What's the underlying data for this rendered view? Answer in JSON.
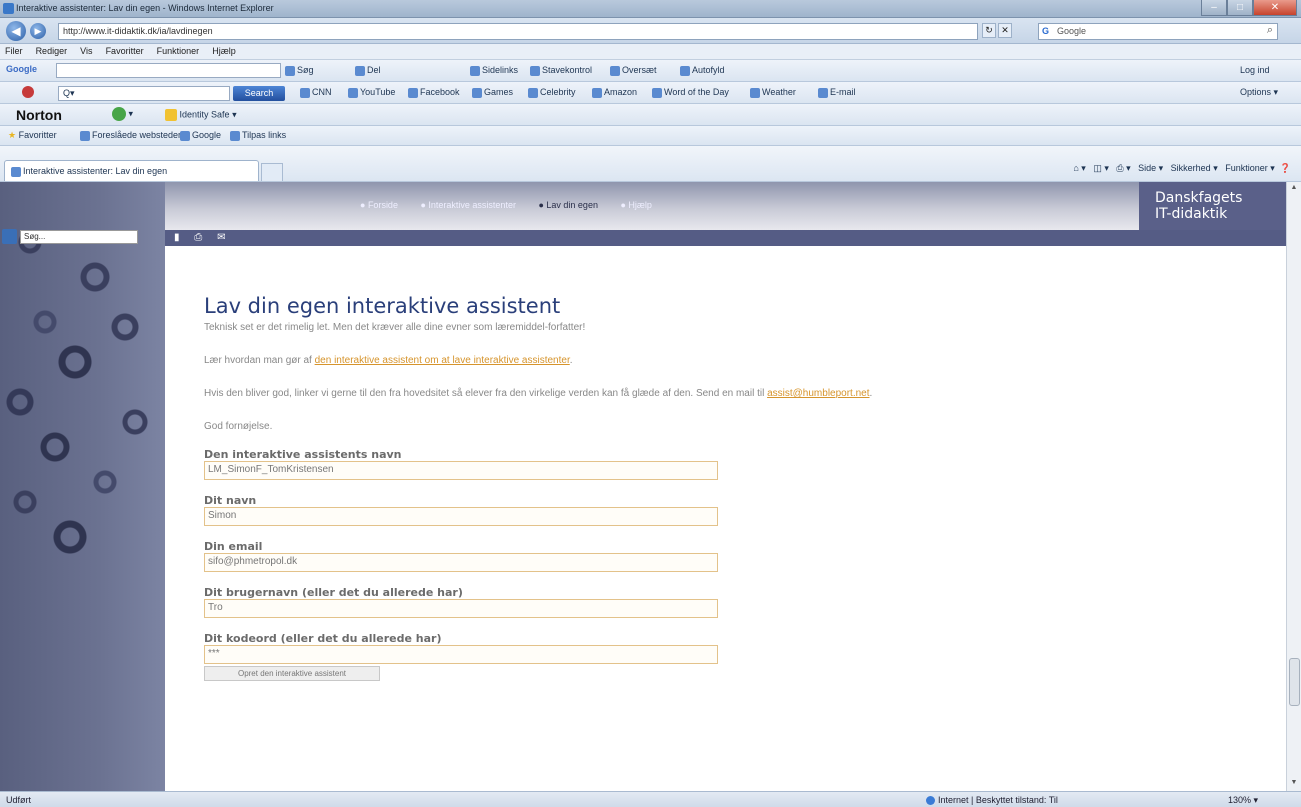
{
  "window": {
    "title": "Interaktive assistenter: Lav din egen - Windows Internet Explorer"
  },
  "addressbar": {
    "url": "http://www.it-didaktik.dk/ia/lavdinegen",
    "search_engine": "Google",
    "search_placeholder": "Google"
  },
  "menubar": [
    "Filer",
    "Rediger",
    "Vis",
    "Favoritter",
    "Funktioner",
    "Hjælp"
  ],
  "google_toolbar": {
    "label": "Google",
    "items": [
      "Søg",
      "Del",
      "Sidelinks",
      "Stavekontrol",
      "Oversæt",
      "Autofyld"
    ],
    "right": "Log ind"
  },
  "ask_toolbar": {
    "search_button": "Search",
    "items": [
      "CNN",
      "YouTube",
      "Facebook",
      "Games",
      "Celebrity",
      "Amazon",
      "Word of the Day",
      "Weather",
      "E-mail"
    ],
    "right": "Options"
  },
  "norton_toolbar": {
    "brand": "Norton",
    "item": "Identity Safe"
  },
  "favorites_bar": {
    "label": "Favoritter",
    "items": [
      "Foreslåede websteder",
      "Google",
      "Tilpas links"
    ]
  },
  "tabs": [
    {
      "label": "Interaktive assistenter: Lav din egen"
    }
  ],
  "commandbar": {
    "items": [
      "Side",
      "Sikkerhed",
      "Funktioner"
    ]
  },
  "site": {
    "search_value": "Søg...",
    "nav_links": [
      "Forside",
      "Interaktive assistenter",
      "Lav din egen",
      "Hjælp"
    ],
    "current_nav": "Lav din egen",
    "brand_line1": "Danskfagets",
    "brand_line2": "IT-didaktik"
  },
  "content": {
    "heading": "Lav din egen interaktive assistent",
    "intro": "Teknisk set er det rimelig let. Men det kræver alle dine evner som læremiddel-forfatter!",
    "learn_prefix": "Lær hvordan man gør af ",
    "learn_link": "den interaktive assistent om at lave interaktive assistenter",
    "learn_suffix": ".",
    "share_text": "Hvis den bliver god, linker vi gerne til den fra hovedsitet så elever fra den virkelige verden kan få glæde af den. Send en mail til ",
    "share_email": "assist@humbleport.net",
    "share_suffix": ".",
    "closing": "God fornøjelse.",
    "fields": [
      {
        "label": "Den interaktive assistents navn",
        "value": "LM_SimonF_TomKristensen"
      },
      {
        "label": "Dit navn",
        "value": "Simon"
      },
      {
        "label": "Din email",
        "value": "sifo@phmetropol.dk"
      },
      {
        "label": "Dit brugernavn (eller det du allerede har)",
        "value": "Tro"
      },
      {
        "label": "Dit kodeord (eller det du allerede har)",
        "value": "***"
      }
    ],
    "submit_label": "Opret den interaktive assistent"
  },
  "statusbar": {
    "left": "Udført",
    "zone": "Internet | Beskyttet tilstand: Til",
    "zoom": "130%"
  }
}
